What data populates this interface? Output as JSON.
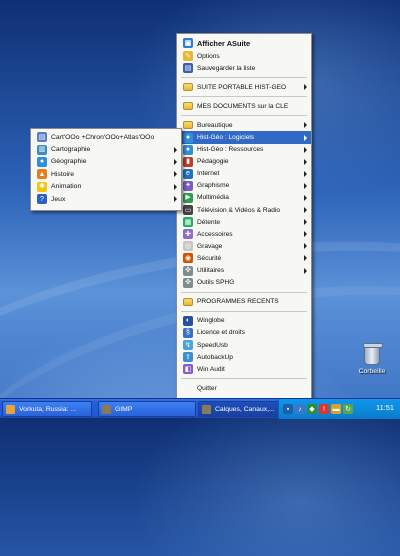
{
  "main_menu": {
    "items": [
      {
        "label": "Afficher ASuite",
        "icon": "asuite-icon",
        "bold": true
      },
      {
        "label": "Options",
        "icon": "wrench-icon"
      },
      {
        "label": "Sauvegarder la liste",
        "icon": "save-icon"
      },
      {
        "sep": true
      },
      {
        "label": "SUITE PORTABLE HIST-GEO",
        "icon": "folder-icon",
        "arrow": true
      },
      {
        "sep": true
      },
      {
        "label": "MES DOCUMENTS sur la  CLE",
        "icon": "folder-icon"
      },
      {
        "sep": true
      },
      {
        "label": "Bureautique",
        "icon": "folder-icon",
        "arrow": true
      },
      {
        "label": "Hist-Géo : Logiciels",
        "icon": "globe-icon",
        "arrow": true,
        "highlighted": true
      },
      {
        "label": "Hist-Géo : Ressources",
        "icon": "globe-icon",
        "arrow": true
      },
      {
        "label": "Pédagogie",
        "icon": "book-icon",
        "arrow": true
      },
      {
        "label": "Internet",
        "icon": "internet-icon",
        "arrow": true
      },
      {
        "label": "Graphisme",
        "icon": "paint-icon",
        "arrow": true
      },
      {
        "label": "Multimédia",
        "icon": "media-icon",
        "arrow": true
      },
      {
        "label": "Télévision & Vidéos & Radio",
        "icon": "tv-icon",
        "arrow": true
      },
      {
        "label": "Détente",
        "icon": "game-icon",
        "arrow": true
      },
      {
        "label": "Accessoires",
        "icon": "accessories-icon",
        "arrow": true
      },
      {
        "label": "Gravage",
        "icon": "cd-icon",
        "arrow": true
      },
      {
        "label": "Sécurité",
        "icon": "security-icon",
        "arrow": true
      },
      {
        "label": "Utilitaires",
        "icon": "tools-icon",
        "arrow": true
      },
      {
        "label": "Outils SPHG",
        "icon": "tools-icon"
      },
      {
        "sep": true
      },
      {
        "label": "PROGRAMMES RECENTS",
        "icon": "folder-icon"
      },
      {
        "sep": true
      },
      {
        "label": "Winglobe",
        "icon": "winglobe-icon"
      },
      {
        "label": "Licence et droits",
        "icon": "license-icon"
      },
      {
        "label": "SpeedUsb",
        "icon": "usb-icon"
      },
      {
        "label": "AutobackUp",
        "icon": "backup-icon"
      },
      {
        "label": "Win Audit",
        "icon": "audit-icon"
      },
      {
        "sep": true
      },
      {
        "label": "Quitter",
        "icon": ""
      }
    ]
  },
  "sub_menu": {
    "items": [
      {
        "label": "Cart'OOo +Chron'OOo+Atlas'OOo",
        "icon": "document-icon"
      },
      {
        "label": "Cartographie",
        "icon": "map-icon",
        "arrow": true
      },
      {
        "label": "Géographie",
        "icon": "globe-icon",
        "arrow": true
      },
      {
        "label": "Histoire",
        "icon": "history-icon",
        "arrow": true
      },
      {
        "label": "Animation",
        "icon": "animation-icon",
        "arrow": true
      },
      {
        "label": "Jeux",
        "icon": "help-icon",
        "arrow": true
      }
    ]
  },
  "desktop": {
    "recycle_bin_label": "Corbeille"
  },
  "taskbar": {
    "buttons": [
      {
        "label": "Vorkuta, Russia: ...",
        "icon": "browser-icon"
      },
      {
        "label": "GIMP",
        "icon": "gimp-icon"
      },
      {
        "label": "Calques, Canaux,...",
        "icon": "gimp-icon"
      }
    ],
    "tray_icons": [
      "network-icon",
      "volume-icon",
      "shield-icon",
      "warning-icon",
      "usb-icon",
      "update-icon"
    ],
    "clock": "11:51"
  },
  "colors": {
    "highlight": "#316ac5",
    "menu_bg": "#f7f7f4",
    "taskbar": "#245edb",
    "tray": "#0d8bdb"
  }
}
